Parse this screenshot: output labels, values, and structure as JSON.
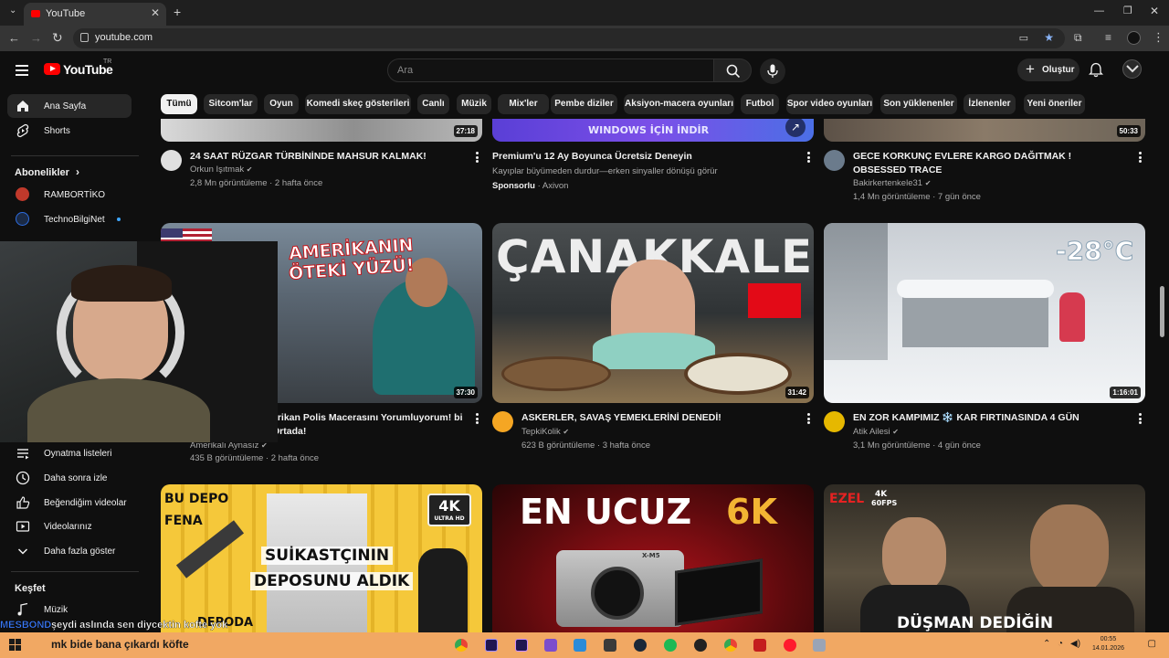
{
  "browser": {
    "tab_title": "YouTube",
    "url": "youtube.com",
    "colors": {
      "tab_bg": "#353535",
      "frame_bg": "#1f1f1f"
    }
  },
  "masthead": {
    "logo_text": "YouTube",
    "country_code": "TR",
    "search_placeholder": "Ara",
    "create_label": "Oluştur",
    "icons": [
      "menu-icon",
      "search-icon",
      "mic-icon",
      "plus-icon",
      "bell-icon",
      "avatar"
    ]
  },
  "chips": [
    {
      "label": "Tümü",
      "active": true
    },
    {
      "label": "Sitcom'lar"
    },
    {
      "label": "Oyun"
    },
    {
      "label": "Komedi skeç gösterileri"
    },
    {
      "label": "Canlı"
    },
    {
      "label": "Müzik"
    },
    {
      "label": "Mix'ler"
    },
    {
      "label": "Pembe diziler"
    },
    {
      "label": "Aksiyon-macera oyunları"
    },
    {
      "label": "Futbol"
    },
    {
      "label": "Spor video oyunları"
    },
    {
      "label": "Son yüklenenler"
    },
    {
      "label": "İzlenenler"
    },
    {
      "label": "Yeni öneriler"
    }
  ],
  "sidebar": {
    "items": [
      {
        "label": "Ana Sayfa",
        "icon": "home-icon",
        "active": true
      },
      {
        "label": "Shorts",
        "icon": "shorts-icon"
      }
    ],
    "subscriptions_heading": "Abonelikler",
    "subscriptions": [
      {
        "label": "RAMBORTİKO",
        "color": "#c0392b"
      },
      {
        "label": "TechnoBilgiNet",
        "color": "#2d6cdf"
      }
    ],
    "you_items": [
      {
        "label": "Oynatma listeleri",
        "icon": "playlist-icon"
      },
      {
        "label": "Daha sonra izle",
        "icon": "clock-icon"
      },
      {
        "label": "Beğendiğim videolar",
        "icon": "thumbs-up-icon"
      },
      {
        "label": "Videolarınız",
        "icon": "video-icon"
      },
      {
        "label": "Daha fazla göster",
        "icon": "chevron-down-icon"
      }
    ],
    "explore_heading": "Keşfet",
    "explore_items": [
      {
        "label": "Müzik",
        "icon": "music-icon"
      }
    ]
  },
  "videos": [
    {
      "title": "24 SAAT RÜZGAR TÜRBİNİNDE MAHSUR KALMAK!",
      "channel": "Orkun Işıtmak",
      "stats": "2,8 Mn görüntüleme · 2 hafta önce",
      "duration": "27:18"
    },
    {
      "title": "Premium'u 12 Ay Boyunca Ücretsiz Deneyin",
      "description": "Kayıplar büyümeden durdur—erken sinyaller dönüşü görür",
      "sponsored": "Sponsorlu",
      "advertiser": "Axivon",
      "banner_text": "WINDOWS İÇİN İNDİR"
    },
    {
      "title": "GECE KORKUNÇ EVLERE KARGO DAĞITMAK ! OBSESSED TRACE",
      "channel": "Bakirkertenkele31",
      "stats": "1,4 Mn görüntüleme · 7 gün önce",
      "duration": "50:33"
    },
    {
      "title": "erikan Polis Macerasını Yorumluyorum! bi Ortada!",
      "channel": "Amerikalı Aynasız",
      "stats": "435 B görüntüleme · 2 hafta önce",
      "duration": "37:30",
      "thumb_text_1": "AMERİKANIN",
      "thumb_text_2": "ÖTEKİ YÜZÜ!"
    },
    {
      "title": "ASKERLER, SAVAŞ YEMEKLERİNİ DENEDİ!",
      "channel": "TepkiKolik",
      "stats": "623 B görüntüleme · 3 hafta önce",
      "duration": "31:42",
      "thumb_text": "ÇANAKKALE"
    },
    {
      "title": "EN ZOR KAMPIMIZ ❄️ KAR FIRTINASINDA 4 GÜN",
      "channel": "Atik Ailesi",
      "stats": "3,1 Mn görüntüleme · 4 gün önce",
      "duration": "1:16:01",
      "thumb_text": "-28°C"
    },
    {
      "thumb_text_1": "BU DEPO",
      "thumb_text_2": "FENA",
      "thumb_text_3": "SUİKASTÇININ",
      "thumb_text_4": "DEPOSUNU ALDIK",
      "thumb_text_5": "4K",
      "thumb_text_6": "ULTRA HD",
      "thumb_text_7": "DEPODA"
    },
    {
      "thumb_text_1": "EN UCUZ",
      "thumb_text_2": "6K",
      "thumb_text_3": "X-M5"
    },
    {
      "thumb_text_1": "EZEL",
      "thumb_text_2": "4K",
      "thumb_text_3": "60FPS",
      "thumb_text_4": "DÜŞMAN DEDİĞİN"
    }
  ],
  "overlay": {
    "chat_user": "MESBOND",
    "chat_message": "şeydi aslında sen diycektin   kofte yok",
    "taskbar_message": "mk bide bana çıkardı köfte",
    "clock_time": "00:55",
    "clock_date": "14.01.2026"
  }
}
